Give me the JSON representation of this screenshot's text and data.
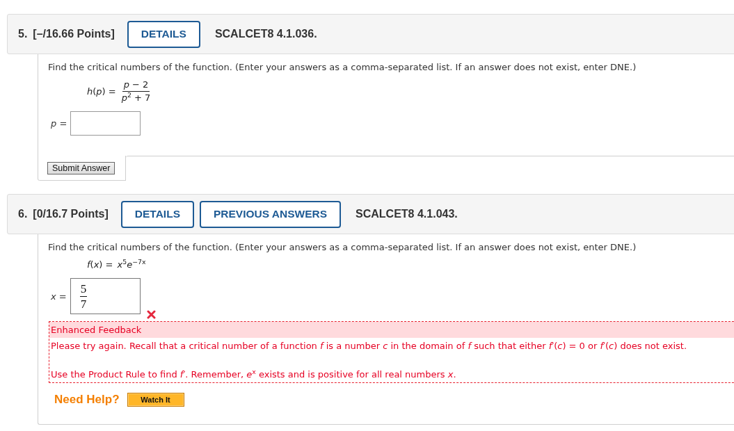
{
  "problems": [
    {
      "number": "5.",
      "points": "[–/16.66 Points]",
      "buttons": [
        "DETAILS"
      ],
      "code": "SCALCET8 4.1.036.",
      "question": "Find the critical numbers of the function. (Enter your answers as a comma-separated list. If an answer does not exist, enter DNE.)",
      "equation": {
        "kind": "fraction",
        "lhs": "*h*(*p*) =",
        "numerator": "*p* − 2",
        "denominator": "*p*$^{2}$ + 7"
      },
      "answer": {
        "label": "*p* ="
      },
      "submit_button": "Submit Answer"
    },
    {
      "number": "6.",
      "points": "[0/16.7 Points]",
      "buttons": [
        "DETAILS",
        "PREVIOUS ANSWERS"
      ],
      "code": "SCALCET8 4.1.043.",
      "question": "Find the critical numbers of the function. (Enter your answers as a comma-separated list. If an answer does not exist, enter DNE.)",
      "equation": {
        "kind": "inline",
        "lhs": "*f*(*x*) =",
        "rhs": "*x*$^{5}$*e*$^{−7x}$"
      },
      "answer": {
        "label": "*x* =",
        "value": {
          "numerator": "5",
          "denominator": "7"
        },
        "correct": false
      },
      "feedback": {
        "title": "Enhanced Feedback",
        "paragraphs": [
          "Please try again. Recall that a critical number of a function *f* is a number *c* in the domain of *f* such that either *f*′(*c*) = 0 or *f*′(*c*) does not exist.",
          "Use the Product Rule to find *f*′. Remember, *e*$^{x}$ exists and is positive for all real numbers *x*."
        ]
      },
      "help": {
        "label": "Need Help?",
        "buttons": [
          "Watch It"
        ]
      }
    }
  ]
}
